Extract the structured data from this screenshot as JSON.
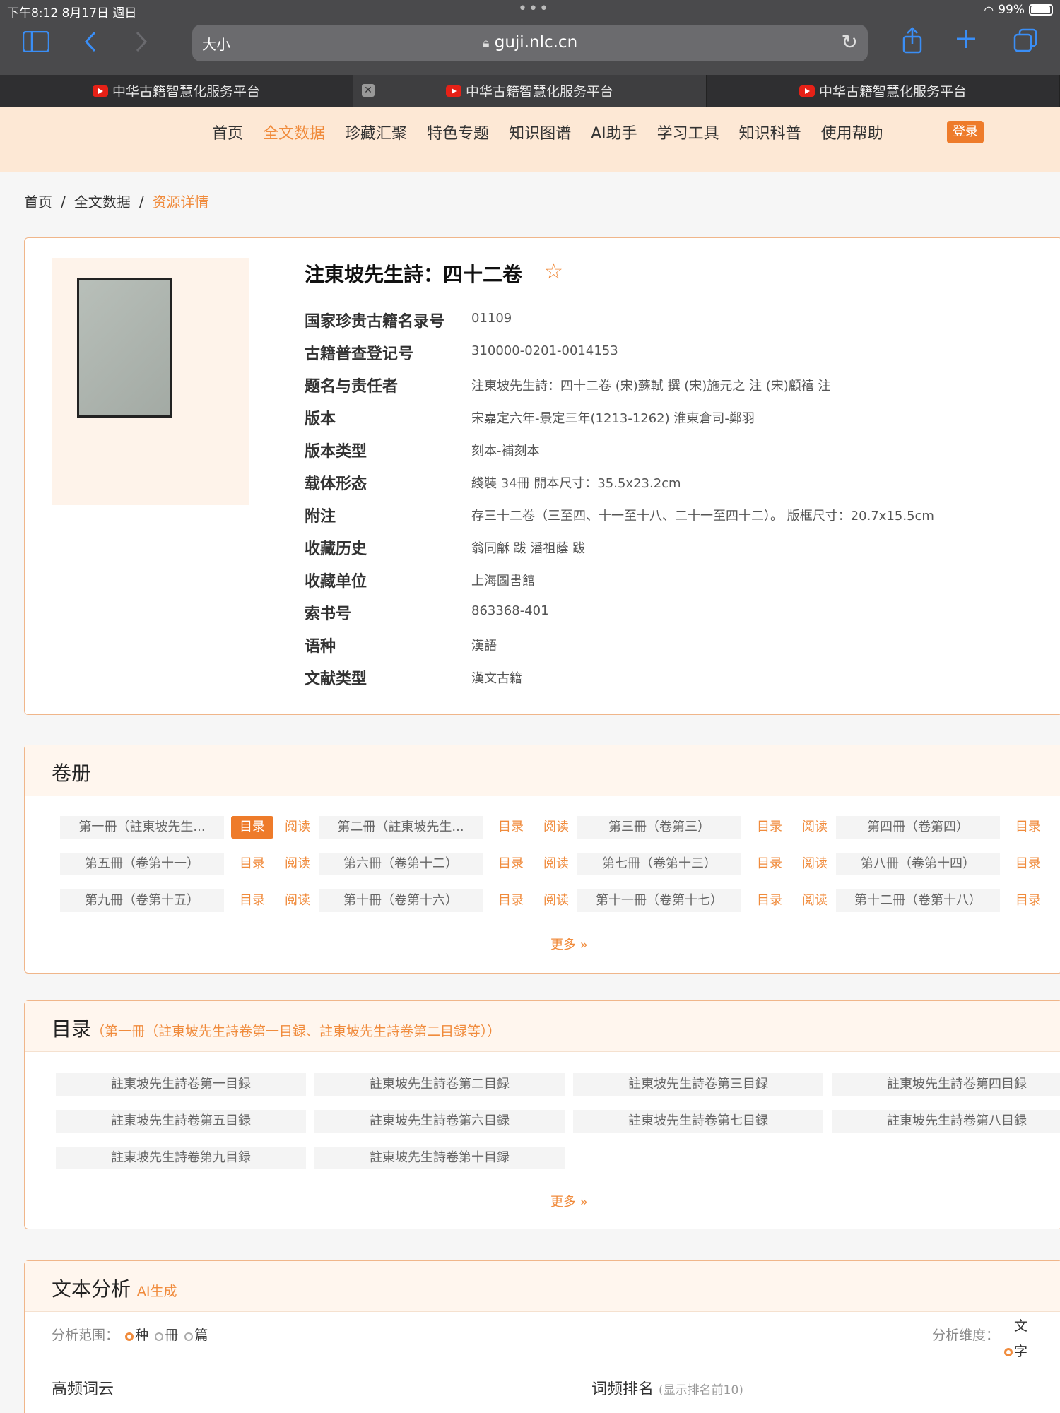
{
  "status_bar": {
    "time_date": "下午8:12   8月17日 週日",
    "battery": "99%"
  },
  "browser": {
    "text_size": "大小",
    "url": "guji.nlc.cn",
    "tabs": [
      {
        "label": "中华古籍智慧化服务平台"
      },
      {
        "label": "中华古籍智慧化服务平台"
      },
      {
        "label": "中华古籍智慧化服务平台"
      }
    ]
  },
  "site_nav": {
    "items": [
      "首页",
      "全文数据",
      "珍藏汇聚",
      "特色专题",
      "知识图谱",
      "AI助手",
      "学习工具",
      "知识科普",
      "使用帮助"
    ],
    "active": "全文数据",
    "login": "登录"
  },
  "breadcrumb": {
    "home": "首页",
    "section": "全文数据",
    "current": "资源详情"
  },
  "detail": {
    "title": "注東坡先生詩：四十二卷",
    "fields": [
      {
        "label": "国家珍贵古籍名录号",
        "value": "01109"
      },
      {
        "label": "古籍普查登记号",
        "value": "310000-0201-0014153"
      },
      {
        "label": "题名与责任者",
        "value": "注東坡先生詩：四十二卷  (宋)蘇軾  撰  (宋)施元之  注  (宋)顧禧  注"
      },
      {
        "label": "版本",
        "value": "宋嘉定六年-景定三年(1213-1262)  淮東倉司-鄭羽"
      },
      {
        "label": "版本类型",
        "value": "刻本-補刻本"
      },
      {
        "label": "载体形态",
        "value": "綫裝  34冊  開本尺寸：35.5x23.2cm"
      },
      {
        "label": "附注",
        "value": "存三十二卷（三至四、十一至十八、二十一至四十二）。  版框尺寸：20.7x15.5cm"
      },
      {
        "label": "收藏历史",
        "value": "翁同龢  跋  潘祖蔭  跋"
      },
      {
        "label": "收藏单位",
        "value": "上海圖書館"
      },
      {
        "label": "索书号",
        "value": "863368-401"
      },
      {
        "label": "语种",
        "value": "漢語"
      },
      {
        "label": "文献类型",
        "value": "漢文古籍"
      }
    ]
  },
  "volumes": {
    "title": "卷册",
    "btn_toc": "目录",
    "btn_read": "阅读",
    "more": "更多 »",
    "items": [
      "第一冊（註東坡先生...",
      "第二冊（註東坡先生...",
      "第三冊（卷第三）",
      "第四冊（卷第四）",
      "第五冊（卷第十一）",
      "第六冊（卷第十二）",
      "第七冊（卷第十三）",
      "第八冊（卷第十四）",
      "第九冊（卷第十五）",
      "第十冊（卷第十六）",
      "第十一冊（卷第十七）",
      "第十二冊（卷第十八）"
    ]
  },
  "toc": {
    "title": "目录",
    "subtitle": "（第一冊（註東坡先生詩卷第一目録、註東坡先生詩卷第二目録等））",
    "more": "更多 »",
    "items": [
      "註東坡先生詩卷第一目録",
      "註東坡先生詩卷第二目録",
      "註東坡先生詩卷第三目録",
      "註東坡先生詩卷第四目録",
      "註東坡先生詩卷第五目録",
      "註東坡先生詩卷第六目録",
      "註東坡先生詩卷第七目録",
      "註東坡先生詩卷第八目録",
      "註東坡先生詩卷第九目録",
      "註東坡先生詩卷第十目録"
    ]
  },
  "analysis": {
    "title": "文本分析",
    "ai_tag": "AI生成",
    "scope_label": "分析范围：",
    "scope_options": [
      "种",
      "冊",
      "篇"
    ],
    "dimension_label": "分析维度：",
    "dimension_options": [
      "文",
      "字"
    ],
    "word_cloud": "高频词云",
    "freq_rank": "词频排名",
    "freq_note": "(显示排名前10)"
  }
}
